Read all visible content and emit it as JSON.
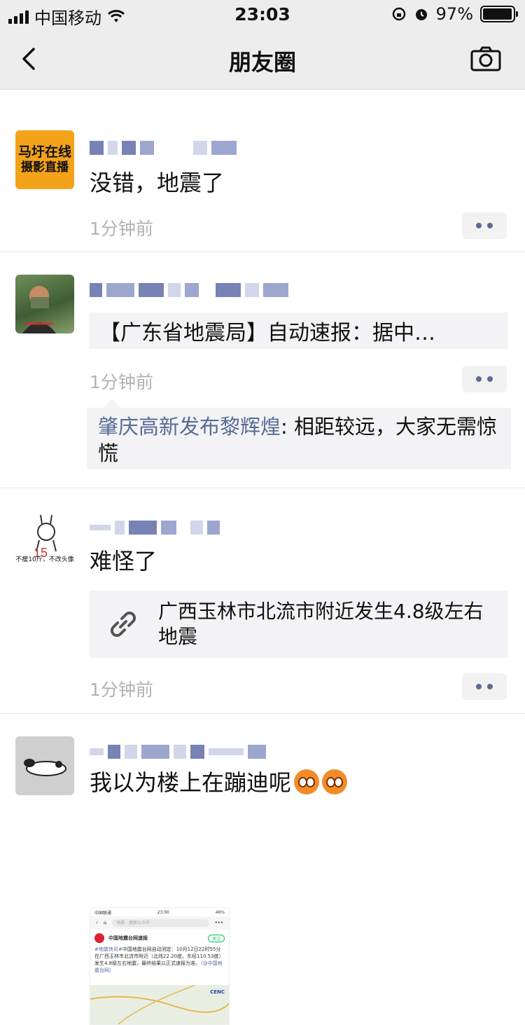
{
  "status_bar": {
    "carrier": "中国移动",
    "time": "23:03",
    "battery": "97%",
    "battery_level": 0.97
  },
  "nav": {
    "title": "朋友圈",
    "back_icon": "chevron-left-icon",
    "camera_icon": "camera-icon"
  },
  "posts": [
    {
      "avatar_text_line1": "马圩在线",
      "avatar_text_line2": "摄影直播",
      "text": "没错，地震了",
      "time": "1分钟前"
    },
    {
      "share_text": "【广东省地震局】自动速报：据中…",
      "time": "1分钟前",
      "comment_author": "肇庆高新发布黎辉煌",
      "comment_text": ": 相距较远，大家无需惊慌"
    },
    {
      "avatar_caption": "不瘦10斤，不改头像",
      "text": "难怪了",
      "link_title": "广西玉林市北流市附近发生4.8级左右地震",
      "time": "1分钟前"
    },
    {
      "text": "我以为楼上在蹦迪呢",
      "screenshot": {
        "carrier": "中国联通",
        "time": "23:00",
        "battery": "46%",
        "search_placeholder": "地震 · 搜索公众号",
        "account": "中国地震台网速报",
        "follow": "关注",
        "tag": "#地震快讯#",
        "body": "中国地震台网自动测定：10月12日22时55分在广西玉林市北流市附近（北纬22.20度，东经110.53度）发生4.8级左右地震，最终结果以正式速报为准。",
        "source": "（@中国地震台网）",
        "map_logo": "CENC"
      }
    }
  ]
}
